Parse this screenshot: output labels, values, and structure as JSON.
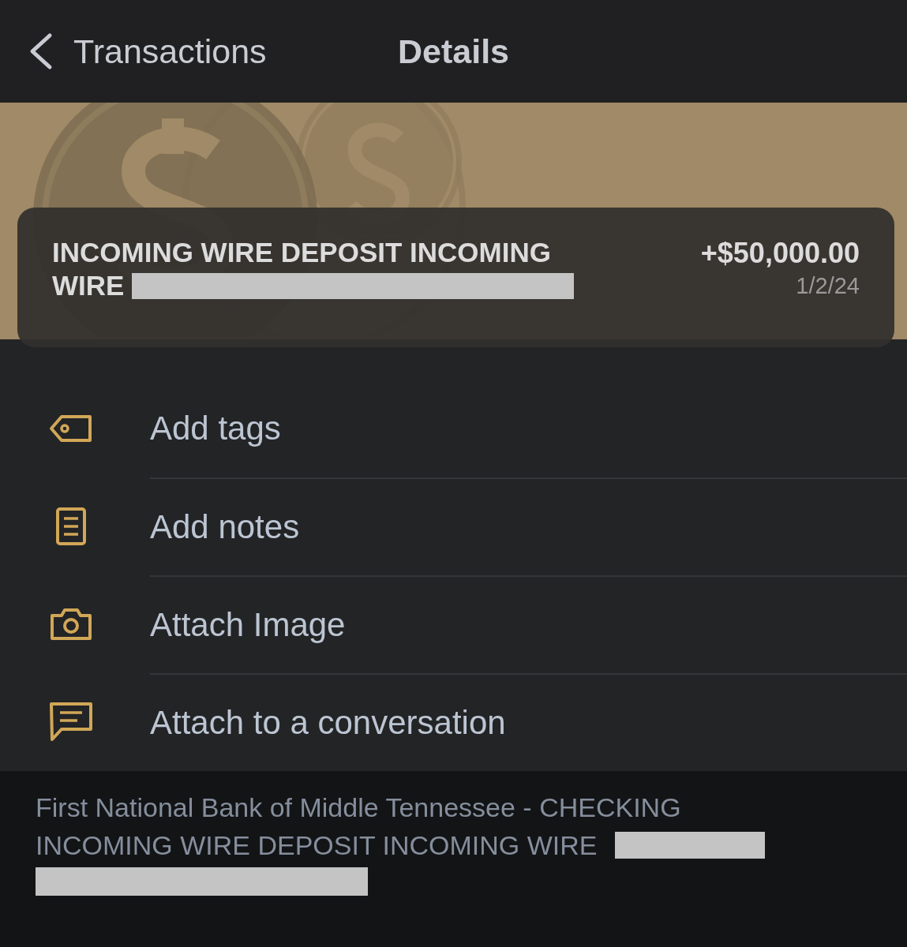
{
  "nav": {
    "back_label": "Transactions",
    "title": "Details"
  },
  "transaction": {
    "description_lines": [
      "INCOMING WIRE DEPOSIT INCOMING",
      "WIRE"
    ],
    "amount": "+$50,000.00",
    "date": "1/2/24"
  },
  "actions": [
    {
      "kind": "tag",
      "label": "Add tags"
    },
    {
      "kind": "notes",
      "label": "Add notes"
    },
    {
      "kind": "camera",
      "label": "Attach Image"
    },
    {
      "kind": "chat",
      "label": "Attach to a conversation"
    }
  ],
  "footer": {
    "lines": [
      "First National Bank of Middle Tennessee - CHECKING",
      "INCOMING WIRE DEPOSIT INCOMING WIRE"
    ]
  }
}
